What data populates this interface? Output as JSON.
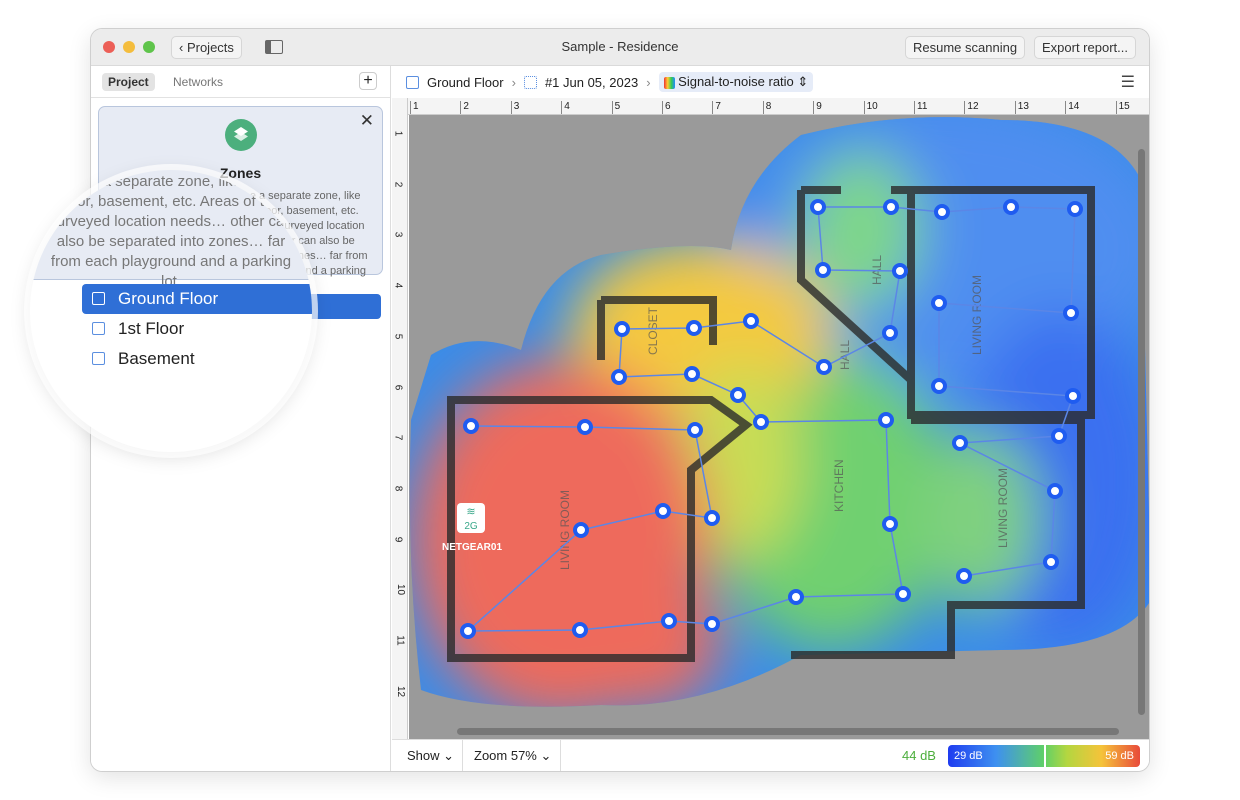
{
  "window": {
    "title": "Sample - Residence",
    "back_label": "Projects",
    "resume_label": "Resume scanning",
    "export_label": "Export report..."
  },
  "sidebar": {
    "tabs": [
      "Project",
      "Networks"
    ],
    "zones_card": {
      "title": "Zones",
      "text_visible": "…to be a separate zone, like ground floor, basement, etc. Areas of the surveyed location needs… other can also be separated into zones… far from each playground and a parking lot."
    },
    "items": [
      {
        "label": "Ground Floor",
        "selected": true
      },
      {
        "label": "1st Floor"
      },
      {
        "label": "Basement"
      }
    ]
  },
  "breadcrumb": {
    "floor": "Ground Floor",
    "survey": "#1 Jun 05, 2023",
    "visualization": "Signal-to-noise ratio"
  },
  "ruler": {
    "h": [
      "1",
      "2",
      "3",
      "4",
      "5",
      "6",
      "7",
      "8",
      "9",
      "10",
      "11",
      "12",
      "13",
      "14",
      "15"
    ],
    "v": [
      "1",
      "2",
      "3",
      "4",
      "5",
      "6",
      "7",
      "8",
      "9",
      "10",
      "11",
      "12"
    ]
  },
  "floorplan": {
    "rooms": [
      "CLOSET",
      "HALL",
      "HALL",
      "LIVING ROOM",
      "LIVING ROOM",
      "KITCHEN",
      "LIVING ROOM"
    ],
    "access_point": {
      "band": "2G",
      "name": "NETGEAR01"
    }
  },
  "bottom": {
    "show_label": "Show",
    "zoom_label": "Zoom 57%",
    "current_value": "44 dB",
    "legend_min": "29 dB",
    "legend_max": "59 dB",
    "legend_marker_fraction": 0.5
  },
  "colors": {
    "accent": "#2f6fd6",
    "zones_icon": "#4caf7d",
    "point": "#1f5cf0",
    "current_value": "#4cae3c"
  }
}
